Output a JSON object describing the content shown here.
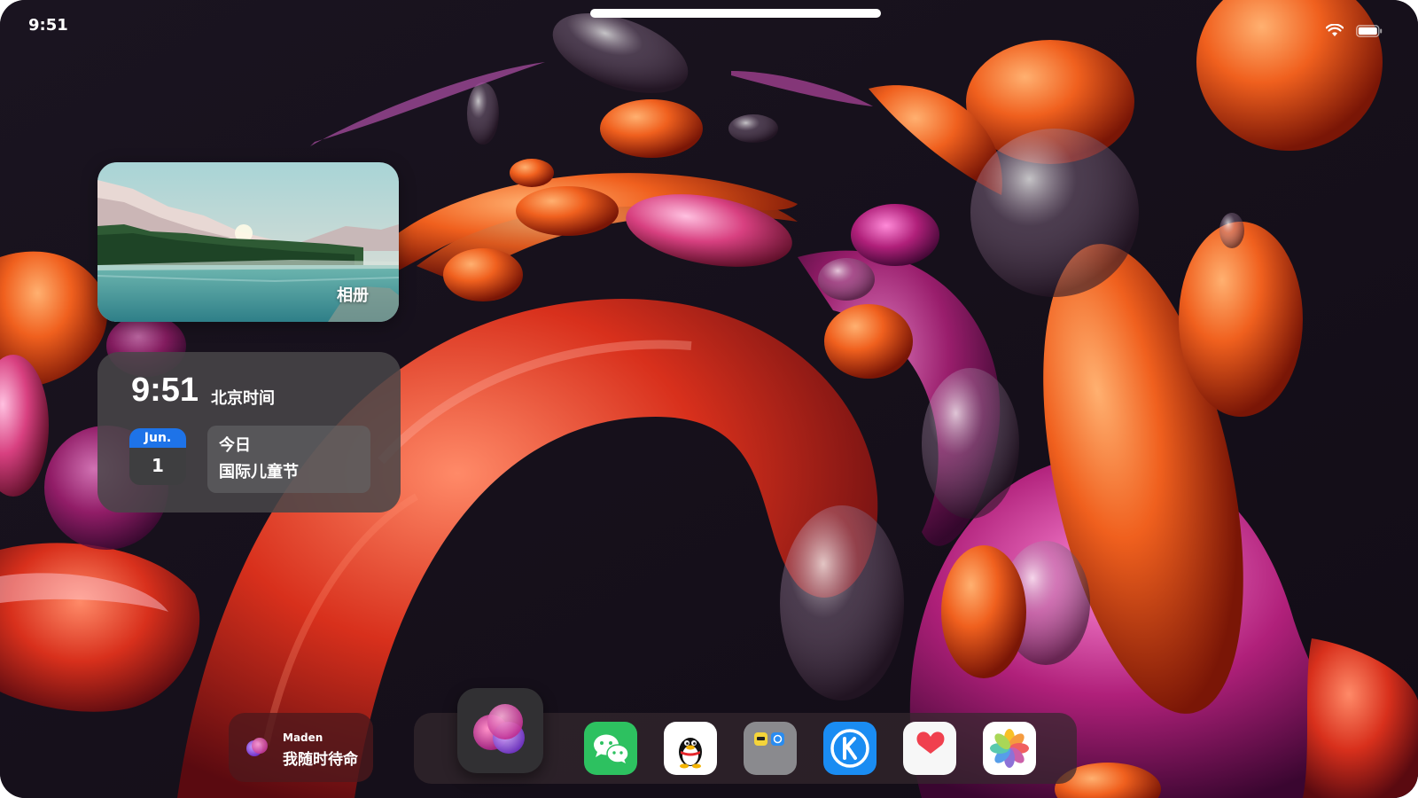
{
  "status_bar": {
    "time": "9:51",
    "wifi_icon": "wifi-icon",
    "battery_icon": "battery-icon"
  },
  "photo_widget": {
    "label": "相册"
  },
  "clock_widget": {
    "time": "9:51",
    "timezone": "北京时间",
    "calendar_month": "Jun.",
    "calendar_day": "1",
    "event_title": "今日",
    "event_name": "国际儿童节"
  },
  "assistant": {
    "name": "Maden",
    "status": "我随时待命"
  },
  "dock": {
    "apps": [
      {
        "icon": "assistant-orb-icon"
      },
      {
        "icon": "wechat-icon"
      },
      {
        "icon": "qq-penguin-icon"
      },
      {
        "icon": "app-folder-icon"
      },
      {
        "icon": "kugou-music-icon"
      },
      {
        "icon": "health-heart-icon"
      },
      {
        "icon": "photos-flower-icon"
      }
    ]
  },
  "colors": {
    "background": "#16101a",
    "calendar_accent": "#1e73e8",
    "wechat_green": "#2dc160",
    "kugou_blue": "#1a8cf2",
    "heart_red": "#f0404e"
  }
}
